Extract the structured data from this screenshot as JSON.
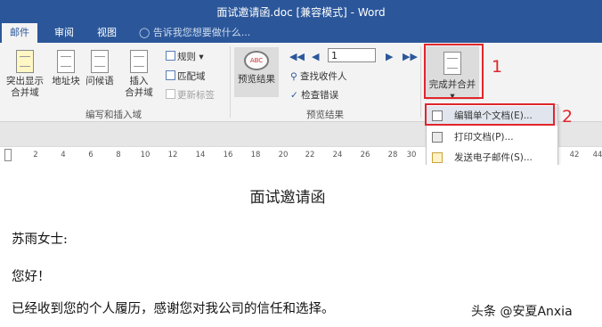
{
  "window": {
    "title": "面试邀请函.doc [兼容模式] - Word"
  },
  "tabs": [
    {
      "label": "邮件",
      "active": true
    },
    {
      "label": "审阅",
      "active": false
    },
    {
      "label": "视图",
      "active": false
    }
  ],
  "tell_me": {
    "placeholder": "告诉我您想要做什么..."
  },
  "ribbon": {
    "write_group": {
      "buttons": [
        "突出显示",
        "合并域",
        "地址块",
        "问候语",
        "插入",
        "合并域"
      ],
      "rules_label": "规则",
      "match_fields_label": "匹配域",
      "update_labels_label": "更新标签",
      "group_label": "编写和插入域"
    },
    "preview_group": {
      "preview_label": "预览结果",
      "record_value": "1",
      "find_recipient_label": "查找收件人",
      "check_errors_label": "检查错误",
      "group_label": "预览结果"
    },
    "finish": {
      "label": "完成并合并",
      "menu": [
        {
          "label": "编辑单个文档(E)..."
        },
        {
          "label": "打印文档(P)..."
        },
        {
          "label": "发送电子邮件(S)..."
        }
      ]
    }
  },
  "annotations": {
    "callout_1": "1",
    "callout_2": "2"
  },
  "ruler": {
    "ticks": [
      "2",
      "4",
      "6",
      "8",
      "10",
      "12",
      "14",
      "16",
      "18",
      "20",
      "22",
      "24",
      "26",
      "28",
      "30",
      "42",
      "44"
    ]
  },
  "document": {
    "heading": "面试邀请函",
    "recipient": "苏雨女士:",
    "greeting": "您好！",
    "body": "已经收到您的个人履历，感谢您对我公司的信任和选择。"
  },
  "watermark": "头条 @安夏Anxia",
  "colors": {
    "title_bar": "#2b579a",
    "callout_red": "#e0262b"
  }
}
